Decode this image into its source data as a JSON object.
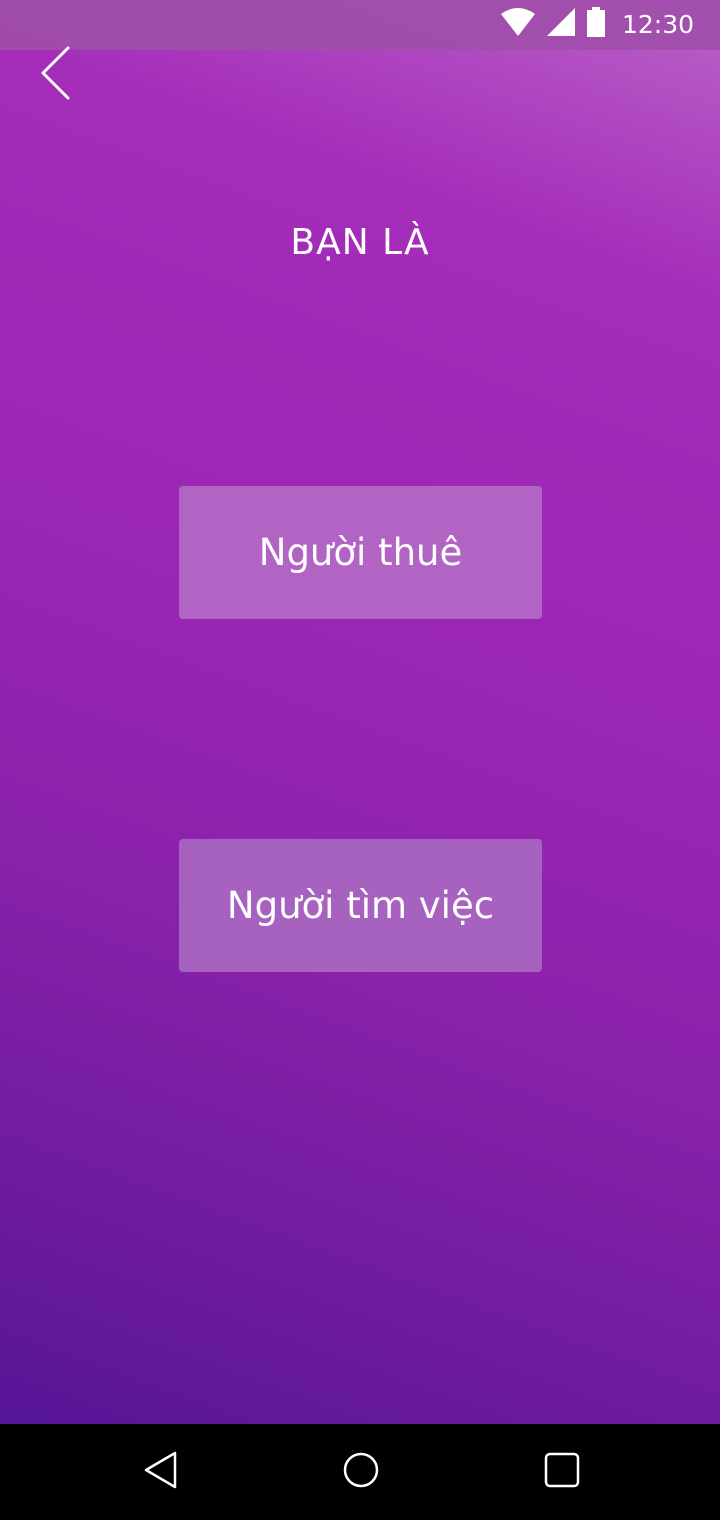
{
  "status_bar": {
    "time": "12:30",
    "icons": [
      "wifi-icon",
      "cell-signal-icon",
      "battery-icon"
    ]
  },
  "header": {
    "back_icon": "chevron-left-icon"
  },
  "main": {
    "title": "BẠN LÀ",
    "options": [
      {
        "label": "Người thuê"
      },
      {
        "label": "Người tìm việc"
      }
    ]
  },
  "nav_bar": {
    "icons": [
      "nav-back-icon",
      "nav-home-icon",
      "nav-recents-icon"
    ]
  },
  "colors": {
    "gradient_top": "#bb62c8",
    "gradient_mid": "#9a26b4",
    "gradient_bottom": "#561597",
    "status_bar": "#a04eaa",
    "button_employer": "#b164c4",
    "button_jobseeker": "#a762bf",
    "nav_bar": "#000000"
  }
}
